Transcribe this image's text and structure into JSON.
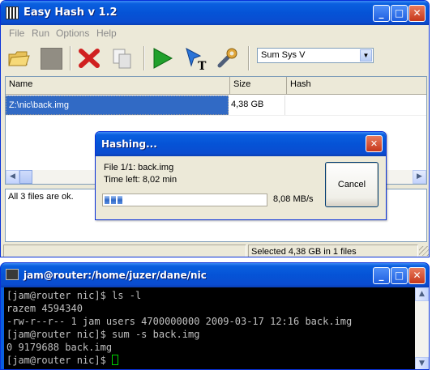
{
  "hash_window": {
    "title": "Easy Hash v 1.2",
    "menu": [
      "File",
      "Run",
      "Options",
      "Help"
    ],
    "toolbar_icons": [
      "open-folder-icon",
      "stop-icon",
      "delete-icon",
      "copy-icon",
      "run-icon",
      "hash-text-icon",
      "settings-wrench-icon"
    ],
    "algorithm": "Sum Sys V",
    "columns": [
      "Name",
      "Size",
      "Hash"
    ],
    "rows": [
      {
        "name": "Z:\\nic\\back.img",
        "size": "4,38 GB",
        "hash": ""
      }
    ],
    "log": "All 3 files are ok.",
    "status": "Selected 4,38 GB in 1 files"
  },
  "hashing_dialog": {
    "title": "Hashing...",
    "file_line": "File 1/1: back.img",
    "time_line": "Time left: 8,02 min",
    "progress_fraction": 0.12,
    "speed": "8,08 MB/s",
    "cancel_label": "Cancel"
  },
  "terminal": {
    "title": "jam@router:/home/juzer/dane/nic",
    "lines": [
      "[jam@router nic]$ ls -l",
      "razem 4594340",
      "-rw-r--r-- 1 jam users 4700000000 2009-03-17 12:16 back.img",
      "[jam@router nic]$ sum -s back.img",
      "0 9179688 back.img",
      "[jam@router nic]$ "
    ]
  },
  "colors": {
    "titlebar": "#0553d6",
    "window_bg": "#ece9d8",
    "selection": "#316ac5",
    "cursor": "#00d000"
  }
}
